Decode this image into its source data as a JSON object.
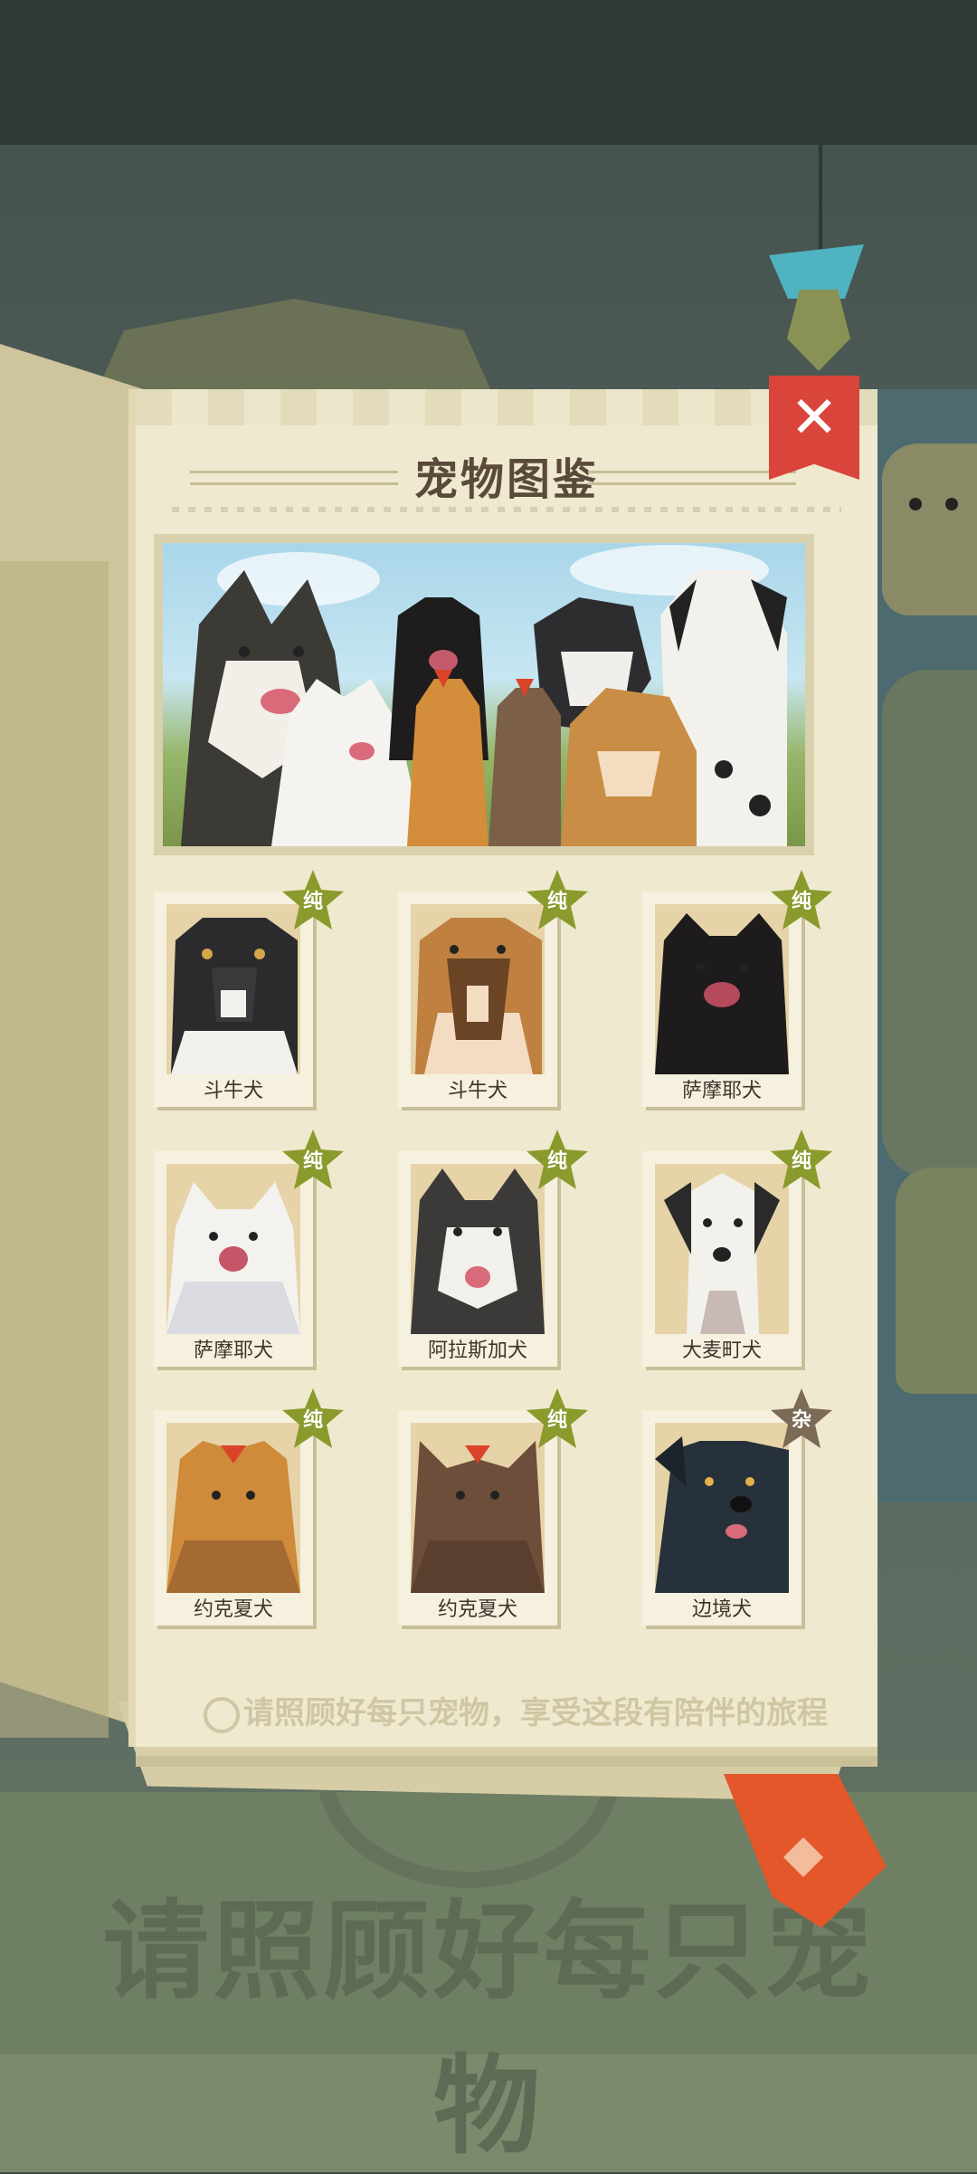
{
  "title": "宠物图鉴",
  "hint": "请照顾好每只宠物，享受这段有陪伴的旅程",
  "background_text": "请照顾好每只宠物",
  "badges": {
    "pure": "纯",
    "mixed": "杂"
  },
  "colors": {
    "pure_badge": "#8a9a2c",
    "mixed_badge": "#7b6a55",
    "close_button": "#d9453a",
    "bookmark": "#e3572b",
    "page": "#efe9cf"
  },
  "pets": [
    {
      "name": "斗牛犬",
      "type": "pure",
      "icon": "black-bulldog"
    },
    {
      "name": "斗牛犬",
      "type": "pure",
      "icon": "tan-bulldog"
    },
    {
      "name": "萨摩耶犬",
      "type": "pure",
      "icon": "black-samoyed"
    },
    {
      "name": "萨摩耶犬",
      "type": "pure",
      "icon": "white-samoyed"
    },
    {
      "name": "阿拉斯加犬",
      "type": "pure",
      "icon": "alaskan-malamute"
    },
    {
      "name": "大麦町犬",
      "type": "pure",
      "icon": "dalmatian"
    },
    {
      "name": "约克夏犬",
      "type": "pure",
      "icon": "yorkshire-tan"
    },
    {
      "name": "约克夏犬",
      "type": "pure",
      "icon": "yorkshire-brown"
    },
    {
      "name": "边境犬",
      "type": "mixed",
      "icon": "black-border-dog"
    }
  ]
}
